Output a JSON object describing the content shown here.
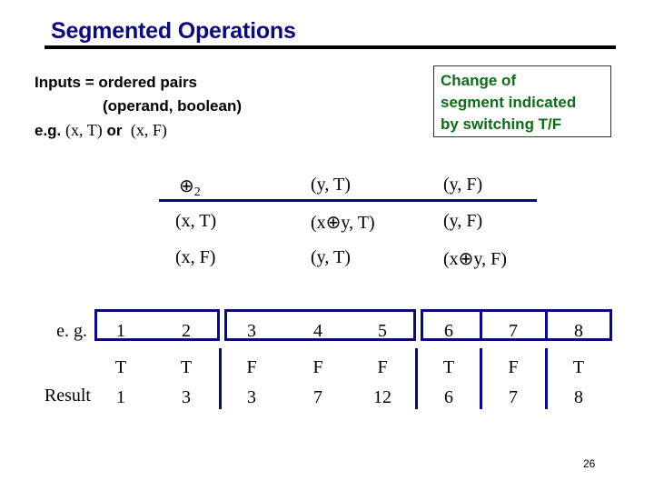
{
  "slide": {
    "title": "Segmented Operations",
    "page_number": "26"
  },
  "inputs": {
    "line1": "Inputs = ordered pairs",
    "line2": "(operand, boolean)",
    "line3_prefix": "e.g.",
    "example1": "(x, T)",
    "or": "or",
    "example2": "(x, F)"
  },
  "note": {
    "lines": [
      "Change of",
      "segment indicated",
      "by switching T/F"
    ],
    "color": "#0f6b1a"
  },
  "operator_table": {
    "operator": "⊕",
    "operator_sub": "2",
    "col_headers": [
      "(y, T)",
      "(y, F)"
    ],
    "rows": [
      {
        "header": "(x, T)",
        "cells": [
          "(x⊕y, T)",
          "(y, F)"
        ]
      },
      {
        "header": "(x, F)",
        "cells": [
          "(y, T)",
          "(x⊕y, F)"
        ]
      }
    ]
  },
  "example": {
    "label_eg": "e. g.",
    "label_result": "Result",
    "values": [
      "1",
      "2",
      "3",
      "4",
      "5",
      "6",
      "7",
      "8"
    ],
    "flags": [
      "T",
      "T",
      "F",
      "F",
      "F",
      "T",
      "F",
      "T"
    ],
    "results": [
      "1",
      "3",
      "3",
      "7",
      "12",
      "6",
      "7",
      "8"
    ],
    "accent_color": "#0a0a7a"
  }
}
